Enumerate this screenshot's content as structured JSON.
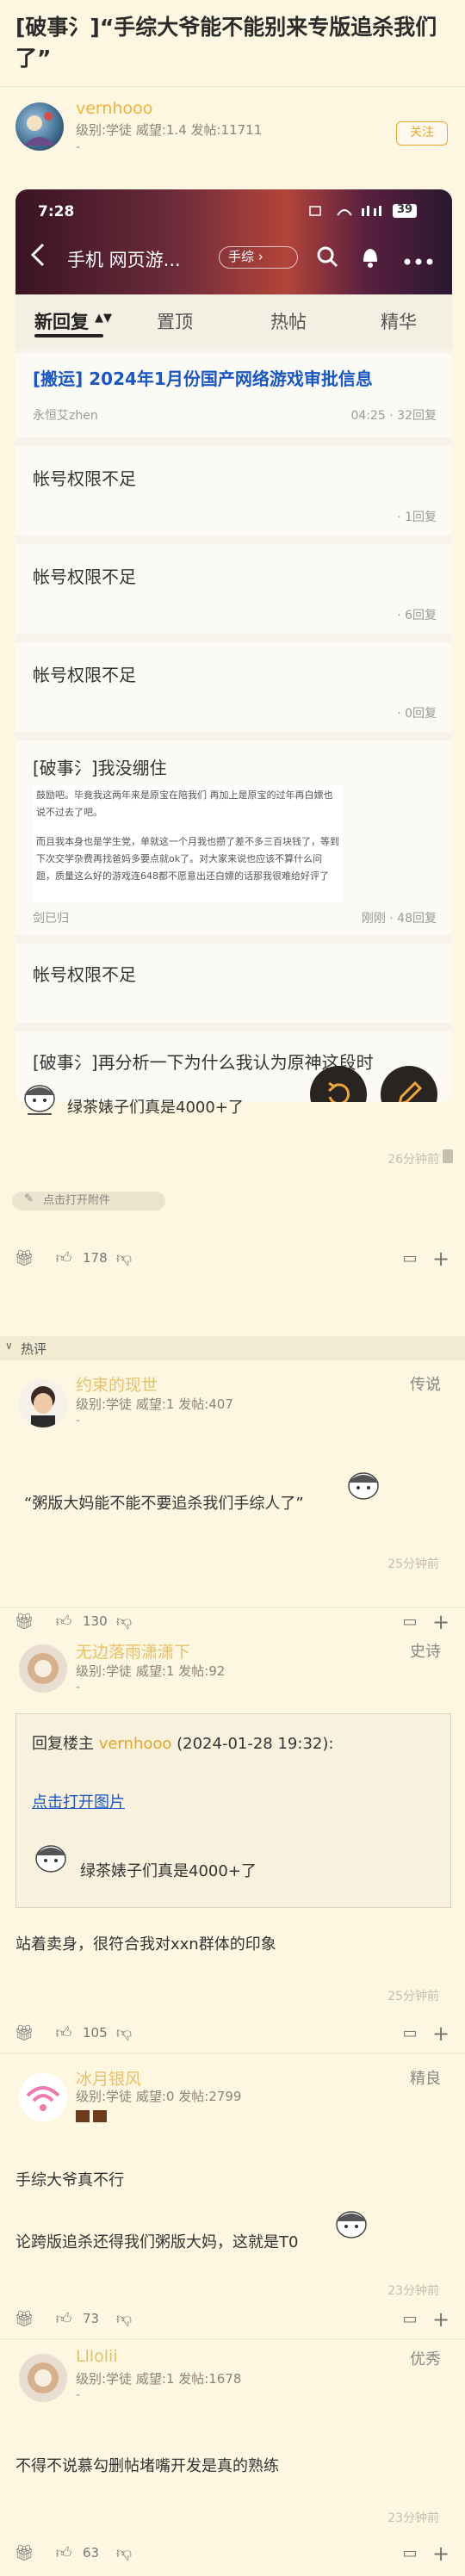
{
  "thread": {
    "title": "[破事氵]“手综大爷能不能别来专版追杀我们了”"
  },
  "op": {
    "name": "vernhooo",
    "meta": "级别:学徒 威望:1.4 发帖:11711",
    "dash": "-",
    "follow": "关注"
  },
  "shot": {
    "status_time": "7:28",
    "battery": "39",
    "nav_title": "手机 网页游...",
    "nav_pill": "手综",
    "tabs": [
      "新回复",
      "置顶",
      "热帖",
      "精华"
    ],
    "posts": [
      {
        "title": "[搬运] 2024年1月份国产网络游戏审批信息",
        "author": "永恒艾zhen",
        "right": "04:25 · 32回复"
      },
      {
        "title": "帐号权限不足",
        "right": "· 1回复"
      },
      {
        "title": "帐号权限不足",
        "right": "· 6回复"
      },
      {
        "title": "帐号权限不足",
        "right": "· 0回复"
      },
      {
        "title": "[破事氵]我没绷住",
        "preview1": "鼓励吧。毕竟我这两年来是原宝在陪我们 再加上是原宝的过年再白嫖也说不过去了吧。",
        "preview2": "而且我本身也是学生党，单就这一个月我也攒了差不多三百块钱了，等到下次交学杂费再找爸妈多要点就ok了。对大家来说也应该不算什么问题，质量这么好的游戏连648都不愿意出还白嫖的话那我很难给好评了",
        "author": "剑已归",
        "right": "刚刚 · 48回复"
      },
      {
        "title": "帐号权限不足"
      },
      {
        "title": "[破事氵]再分析一下为什么我认为原神这段时"
      }
    ],
    "op_text": "绿茶婊子们真是4000+了"
  },
  "op_time": "26分钟前",
  "attach_label": "点击打开附件",
  "op_bar": {
    "likes": "178"
  },
  "hot_label": "热评",
  "replies": [
    {
      "name": "约束的现世",
      "meta": "级别:学徒 威望:1 发帖:407",
      "dash": "-",
      "badge": "传说",
      "text": "“粥版大妈能不能不要追杀我们手综人了”",
      "time": "25分钟前",
      "likes": "130"
    },
    {
      "name": "无边落雨潇潇下",
      "meta": "级别:学徒 威望:1 发帖:92",
      "dash": "-",
      "badge": "史诗",
      "quote_head": "回复楼主 ",
      "quote_user": "vernhooo",
      "quote_date": " (2024-01-28 19:32):",
      "quote_link": "点击打开图片",
      "quote_text": "绿茶婊子们真是4000+了",
      "text": "站着卖身，很符合我对xxn群体的印象",
      "time": "25分钟前",
      "likes": "105"
    },
    {
      "name": "冰月银风",
      "meta": "级别:学徒 威望:0 发帖:2799",
      "badge": "精良",
      "text1": "手综大爷真不行",
      "text2": "论跨版追杀还得我们粥版大妈，这就是T0",
      "time": "23分钟前",
      "likes": "73"
    },
    {
      "name": "Lllolii",
      "meta": "级别:学徒 威望:1 发帖:1678",
      "dash": "-",
      "badge": "优秀",
      "text": "不得不说慕勾删帖堵嘴开发是真的熟练",
      "time": "23分钟前",
      "likes": "63"
    }
  ],
  "colors": {
    "accent": "#e5a629",
    "bg": "#fdf6e0",
    "shot_blue": "#1a57c4"
  }
}
